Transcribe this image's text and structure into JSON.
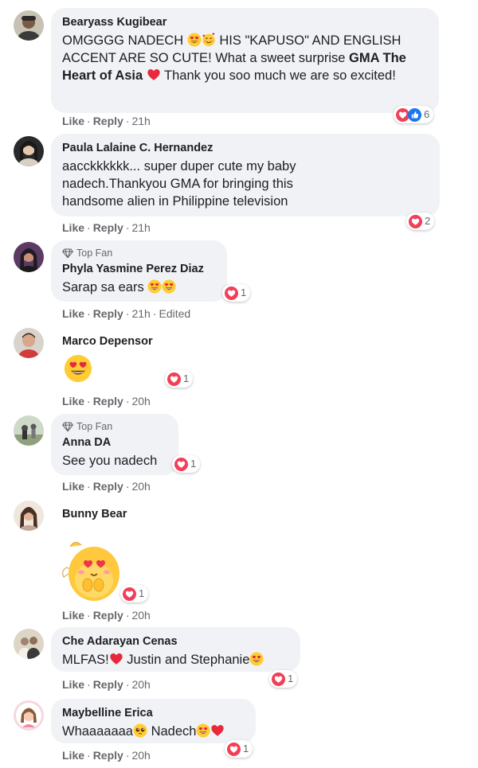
{
  "comments": [
    {
      "author": "Bearyass Kugibear",
      "text_part1": "OMGGGG NADECH ",
      "text_part2": " HIS \"KAPUSO\" AND ENGLISH ACCENT ARE SO CUTE! What a sweet surprise ",
      "text_strong": "GMA The Heart of Asia",
      "text_part3": " Thank you soo much we are so excited!",
      "reaction_count": "6",
      "like": "Like",
      "reply": "Reply",
      "time": "21h"
    },
    {
      "author": "Paula Lalaine C. Hernandez",
      "text": "aacckkkkkk... super duper cute my baby nadech.Thankyou GMA for bringing this handsome alien in Philippine television",
      "reaction_count": "2",
      "like": "Like",
      "reply": "Reply",
      "time": "21h"
    },
    {
      "badge": "Top Fan",
      "author": "Phyla Yasmine Perez Diaz",
      "text": "Sarap sa ears ",
      "reaction_count": "1",
      "like": "Like",
      "reply": "Reply",
      "time": "21h",
      "edited": "Edited"
    },
    {
      "author": "Marco Depensor",
      "reaction_count": "1",
      "like": "Like",
      "reply": "Reply",
      "time": "20h"
    },
    {
      "badge": "Top Fan",
      "author": "Anna DA",
      "text": "See you nadech",
      "reaction_count": "1",
      "like": "Like",
      "reply": "Reply",
      "time": "20h"
    },
    {
      "author": "Bunny Bear",
      "reaction_count": "1",
      "like": "Like",
      "reply": "Reply",
      "time": "20h"
    },
    {
      "author": "Che Adarayan Cenas",
      "text_part1": "MLFAS!",
      "text_part2": " Justin and Stephanie",
      "reaction_count": "1",
      "like": "Like",
      "reply": "Reply",
      "time": "20h"
    },
    {
      "author": "Maybelline Erica",
      "text_part1": "Whaaaaaaa",
      "text_part2": " Nadech",
      "reaction_count": "1",
      "like": "Like",
      "reply": "Reply",
      "time": "20h"
    }
  ],
  "separator": "·",
  "colors": {
    "bubble": "#f0f2f5",
    "meta_text": "#65676b",
    "love_red": "#f33e58",
    "like_blue": "#1877f2"
  },
  "icons": {
    "top_fan": "diamond-icon",
    "love": "love-reaction-icon",
    "like": "like-reaction-icon",
    "heart_eyes": "heart-eyes-emoji",
    "red_heart": "red-heart-emoji",
    "smiling_hearts": "smiling-face-with-hearts-emoji",
    "pleading": "pleading-face-emoji"
  }
}
